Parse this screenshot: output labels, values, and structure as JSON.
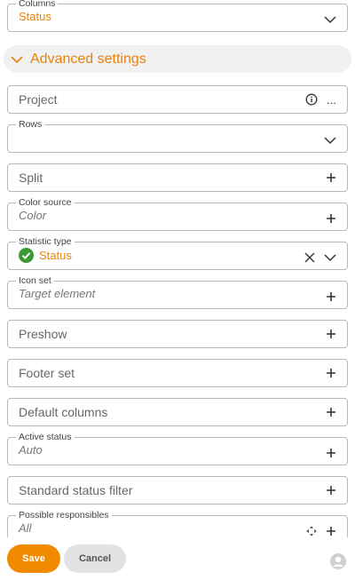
{
  "columns_field": {
    "label": "Columns",
    "value": "Status"
  },
  "advanced_section": {
    "title": "Advanced settings"
  },
  "fields": {
    "project": {
      "placeholder": "Project",
      "more_label": "..."
    },
    "rows": {
      "label": "Rows",
      "value": ""
    },
    "split": {
      "placeholder": "Split"
    },
    "color_source": {
      "label": "Color source",
      "value": "Color"
    },
    "statistic_type": {
      "label": "Statistic type",
      "value": "Status"
    },
    "icon_set": {
      "label": "Icon set",
      "value": "Target element"
    },
    "preshow": {
      "placeholder": "Preshow"
    },
    "footer_set": {
      "placeholder": "Footer set"
    },
    "default_columns": {
      "placeholder": "Default columns"
    },
    "active_status": {
      "label": "Active status",
      "value": "Auto"
    },
    "standard_status_filter": {
      "placeholder": "Standard status filter"
    },
    "possible_responsibles": {
      "label": "Possible responsibles",
      "value": "All"
    }
  },
  "footer": {
    "save_label": "Save",
    "cancel_label": "Cancel"
  },
  "colors": {
    "accent": "#e8830c",
    "success": "#3a9b35"
  }
}
